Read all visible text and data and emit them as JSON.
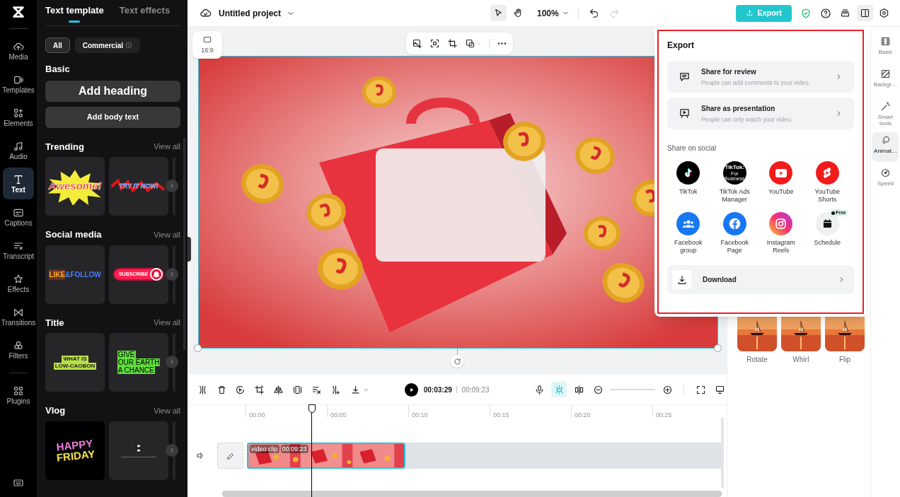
{
  "sidebar": {
    "items": [
      {
        "label": "Media",
        "selected": false
      },
      {
        "label": "Templates",
        "selected": false
      },
      {
        "label": "Elements",
        "selected": false
      },
      {
        "label": "Audio",
        "selected": false
      },
      {
        "label": "Text",
        "selected": true
      },
      {
        "label": "Captions",
        "selected": false
      },
      {
        "label": "Transcript",
        "selected": false
      },
      {
        "label": "Effects",
        "selected": false
      },
      {
        "label": "Transitions",
        "selected": false
      },
      {
        "label": "Filters",
        "selected": false
      },
      {
        "label": "Plugins",
        "selected": false
      }
    ]
  },
  "panel": {
    "tabs": [
      {
        "label": "Text template",
        "selected": true
      },
      {
        "label": "Text effects",
        "selected": false
      }
    ],
    "filters": [
      {
        "label": "All",
        "selected": true,
        "info": false
      },
      {
        "label": "Commercial",
        "selected": false,
        "info": true
      }
    ],
    "basic": {
      "title": "Basic",
      "heading_button": "Add heading",
      "body_button": "Add body text"
    },
    "sections": [
      {
        "title": "Trending",
        "view_all": "View all",
        "templates": [
          {
            "kind": "awesome",
            "lines": [
              "Awesome!"
            ]
          },
          {
            "kind": "try",
            "lines": [
              "TRY IT NOW!"
            ]
          }
        ]
      },
      {
        "title": "Social media",
        "view_all": "View all",
        "templates": [
          {
            "kind": "like",
            "lines": [
              "LIKE",
              "&FOLLOW"
            ]
          },
          {
            "kind": "subscribe",
            "lines": [
              "SUBSCRIBE"
            ]
          }
        ]
      },
      {
        "title": "Title",
        "view_all": "View all",
        "templates": [
          {
            "kind": "lowcarbon",
            "lines": [
              "WHAT IS",
              "LOW-CAOBON"
            ]
          },
          {
            "kind": "earth",
            "lines": [
              "GIVE",
              "OUR EARTH",
              "A CHANCE"
            ]
          }
        ]
      },
      {
        "title": "Vlog",
        "view_all": "View all",
        "templates": [
          {
            "kind": "happy",
            "lines": [
              "HAPPY",
              "FRIDAY"
            ]
          },
          {
            "kind": "hourglass"
          }
        ]
      }
    ]
  },
  "top_bar": {
    "project_title": "Untitled project",
    "zoom": "100%",
    "export_button": "Export"
  },
  "canvas": {
    "aspect_ratio": "16:9"
  },
  "export_menu": {
    "title": "Export",
    "options": [
      {
        "title": "Share for review",
        "description": "People can add comments to your video."
      },
      {
        "title": "Share as presentation",
        "description": "People can only watch your video."
      }
    ],
    "social_title": "Share on social",
    "social": [
      {
        "kind": "tiktok",
        "label": "TikTok"
      },
      {
        "kind": "tiktok_ads",
        "label": "TikTok Ads Manager",
        "logo_lines": [
          "TikTok:",
          "For Business"
        ]
      },
      {
        "kind": "youtube",
        "label": "YouTube"
      },
      {
        "kind": "youtube_shorts",
        "label": "YouTube Shorts"
      },
      {
        "kind": "facebook_group",
        "label": "Facebook group"
      },
      {
        "kind": "facebook_page",
        "label": "Facebook Page"
      },
      {
        "kind": "instagram",
        "label": "Instagram Reels"
      },
      {
        "kind": "schedule",
        "label": "Schedule",
        "badge": "Free"
      }
    ],
    "download": "Download"
  },
  "timeline": {
    "current_time": "00:03:29",
    "total_time": "00:09:23",
    "snap": {
      "selected": true
    },
    "ruler": [
      "00:00",
      "00:05",
      "00:10",
      "00:15",
      "00:20",
      "00:25"
    ],
    "clip": {
      "label": "video clip",
      "duration": "00:09:23"
    }
  },
  "animations": [
    {
      "label": "Rotate"
    },
    {
      "label": "Whirl"
    },
    {
      "label": "Flip"
    }
  ],
  "right_rail": {
    "items": [
      {
        "label": "Basic",
        "selected": false
      },
      {
        "label": "Backgr…",
        "selected": false
      },
      {
        "label": "Smart tools",
        "selected": false
      },
      {
        "label": "Animat…",
        "selected": true
      },
      {
        "label": "Speed",
        "selected": false
      }
    ]
  }
}
